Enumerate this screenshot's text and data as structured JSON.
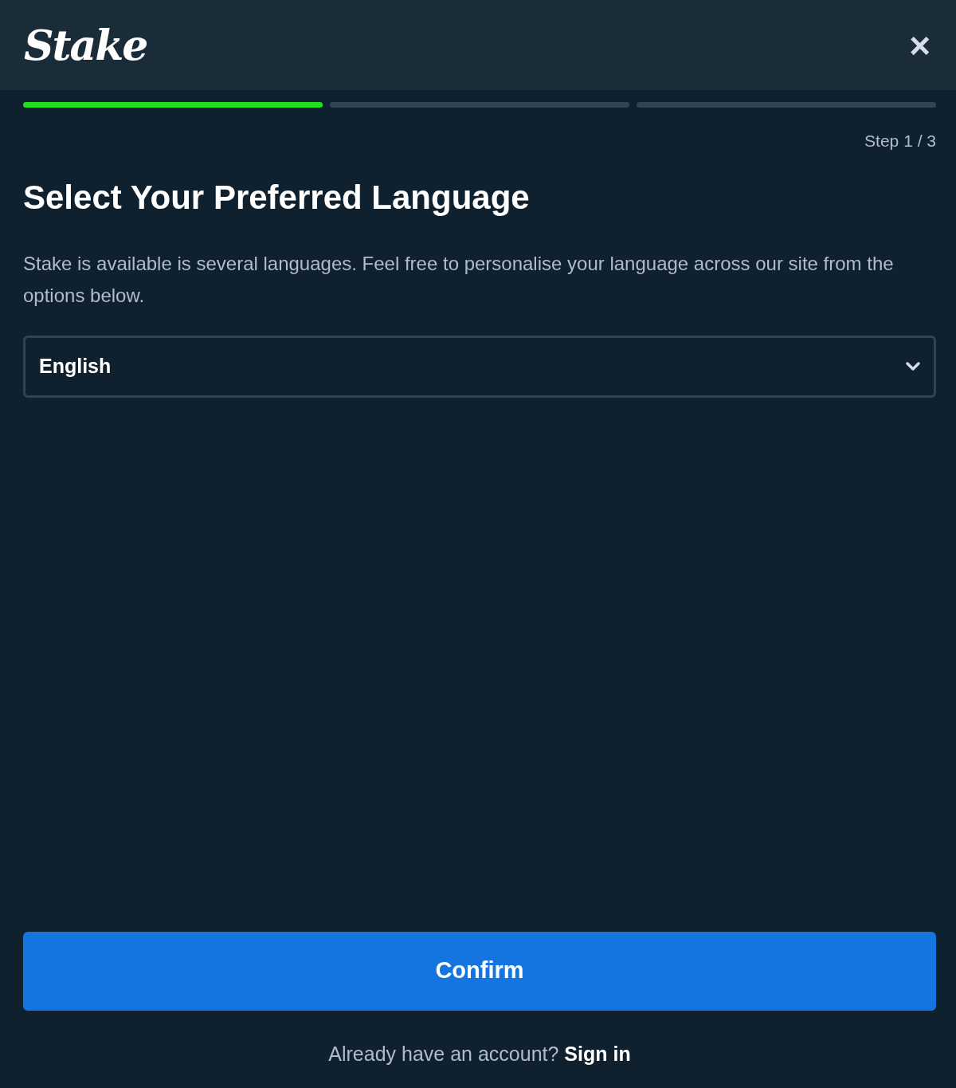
{
  "header": {
    "logo": "Stake",
    "close": "×"
  },
  "progress": [
    {
      "completed": true
    },
    {
      "completed": false
    },
    {
      "completed": false
    }
  ],
  "step_label": "Step 1 / 3",
  "title": "Select Your Preferred Language",
  "description": "Stake is available is several languages. Feel free to personalise your language across our site from the options below.",
  "language_select": {
    "value": "English"
  },
  "confirm_button": "Confirm",
  "footer": {
    "text": "Already have an account?",
    "link": "Sign in"
  }
}
